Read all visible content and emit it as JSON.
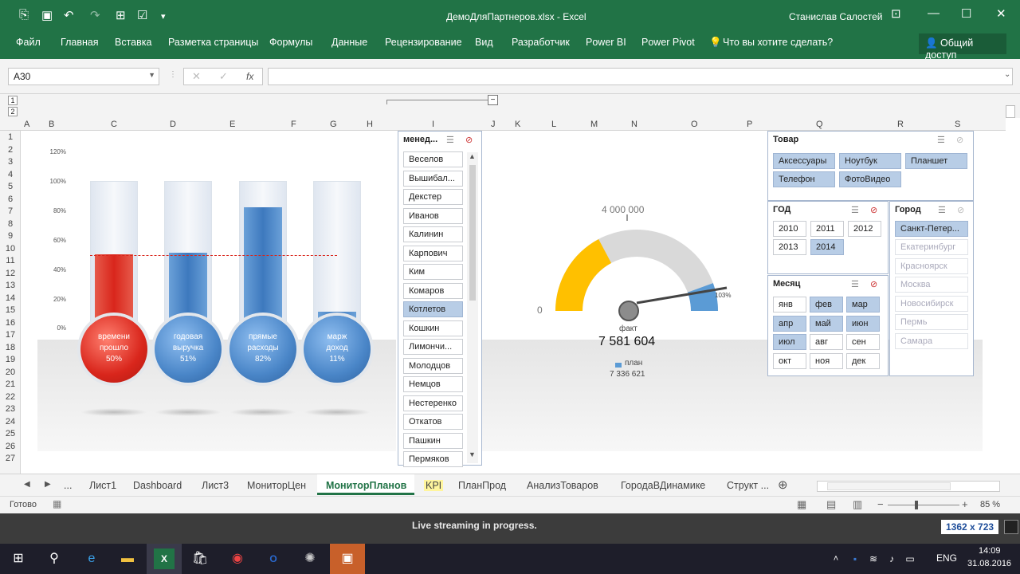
{
  "window": {
    "title": "ДемоДляПартнеров.xlsx - Excel",
    "user": "Станислав Салостей"
  },
  "icons": {
    "autosave": "autosave-icon",
    "save": "save-icon",
    "undo": "undo-icon",
    "redo": "redo-icon",
    "form": "form-icon",
    "check": "check-icon",
    "more": "more-icon",
    "ribbon_display": "ribbon-display-icon",
    "minimize": "minimize-icon",
    "maximize": "maximize-icon",
    "close": "close-icon",
    "lightbulb": "lightbulb-icon",
    "person": "person-icon"
  },
  "ribbon": {
    "tabs": [
      "Файл",
      "Главная",
      "Вставка",
      "Разметка страницы",
      "Формулы",
      "Данные",
      "Рецензирование",
      "Вид",
      "Разработчик",
      "Power BI",
      "Power Pivot"
    ],
    "tell_me": "Что вы хотите сделать?",
    "share": "Общий доступ"
  },
  "formula": {
    "name_box": "A30",
    "fx": "fx",
    "value": ""
  },
  "outline": {
    "levels": [
      "1",
      "2"
    ]
  },
  "columns": [
    "A",
    "B",
    "C",
    "D",
    "E",
    "F",
    "G",
    "H",
    "I",
    "J",
    "K",
    "L",
    "M",
    "N",
    "O",
    "P",
    "Q",
    "R",
    "S"
  ],
  "rows": [
    "1",
    "2",
    "3",
    "4",
    "5",
    "6",
    "7",
    "8",
    "9",
    "10",
    "11",
    "12",
    "13",
    "14",
    "15",
    "16",
    "17",
    "18",
    "19",
    "20",
    "21",
    "22",
    "23",
    "24",
    "25",
    "26",
    "27"
  ],
  "thermo_chart": {
    "ticks": [
      "120%",
      "100%",
      "80%",
      "60%",
      "40%",
      "20%",
      "0%"
    ],
    "bars": [
      {
        "label": "времени\nпрошло",
        "value_text": "50%",
        "value": 0.5
      },
      {
        "label": "годовая\nвыручка",
        "value_text": "51%",
        "value": 0.51
      },
      {
        "label": "прямые\nрасходы",
        "value_text": "82%",
        "value": 0.82
      },
      {
        "label": "марж\nдоход",
        "value_text": "11%",
        "value": 0.11
      }
    ],
    "colors": {
      "red": "#d9261c",
      "blue": "#4a86c8"
    }
  },
  "manager_slicer": {
    "title": "менед...",
    "items": [
      "Веселов",
      "Вышибал...",
      "Декстер",
      "Иванов",
      "Калинин",
      "Карпович",
      "Ким",
      "Комаров",
      "Котлетов",
      "Кошкин",
      "Лимончи...",
      "Молодцов",
      "Немцов",
      "Нестеренко",
      "Откатов",
      "Пашкин",
      "Пермяков"
    ],
    "selected": "Котлетов"
  },
  "gauge": {
    "max_text": "4 000 000",
    "min_text": "0",
    "pct_text": "103%",
    "fact_label": "факт",
    "fact_value": "7 581 604",
    "plan_label": "план",
    "plan_value": "7 336 621",
    "colors": {
      "yellow": "#ffc000",
      "grey": "#d9d9d9",
      "blue": "#5b9bd5"
    }
  },
  "product_slicer": {
    "title": "Товар",
    "items": [
      "Аксессуары",
      "Ноутбук",
      "Планшет",
      "Телефон",
      "ФотоВидео"
    ]
  },
  "year_slicer": {
    "title": "ГОД",
    "items": [
      "2010",
      "2011",
      "2012",
      "2013",
      "2014"
    ],
    "selected": "2014"
  },
  "city_slicer": {
    "title": "Город",
    "items": [
      "Санкт-Петер...",
      "Екатеринбург",
      "Красноярск",
      "Москва",
      "Новосибирск",
      "Пермь",
      "Самара"
    ],
    "selected": "Санкт-Петер..."
  },
  "month_slicer": {
    "title": "Месяц",
    "items": [
      "янв",
      "фев",
      "мар",
      "апр",
      "май",
      "июн",
      "июл",
      "авг",
      "сен",
      "окт",
      "ноя",
      "дек"
    ],
    "selected": [
      "фев",
      "мар",
      "апр",
      "май",
      "июн",
      "июл"
    ]
  },
  "sheet_tabs": {
    "items": [
      "...",
      "Лист1",
      "Dashboard",
      "Лист3",
      "МониторЦен",
      "МониторПланов",
      "KPI",
      "ПланПрод",
      "АнализТоваров",
      "ГородаВДинамике",
      "Структ ..."
    ],
    "active": "МониторПланов"
  },
  "status": {
    "ready": "Готово",
    "zoom": "85 %"
  },
  "stream": {
    "text": "Live streaming in progress.",
    "size": "1362 x 723"
  },
  "taskbar": {
    "lang": "ENG",
    "time": "14:09",
    "date": "31.08.2016"
  }
}
